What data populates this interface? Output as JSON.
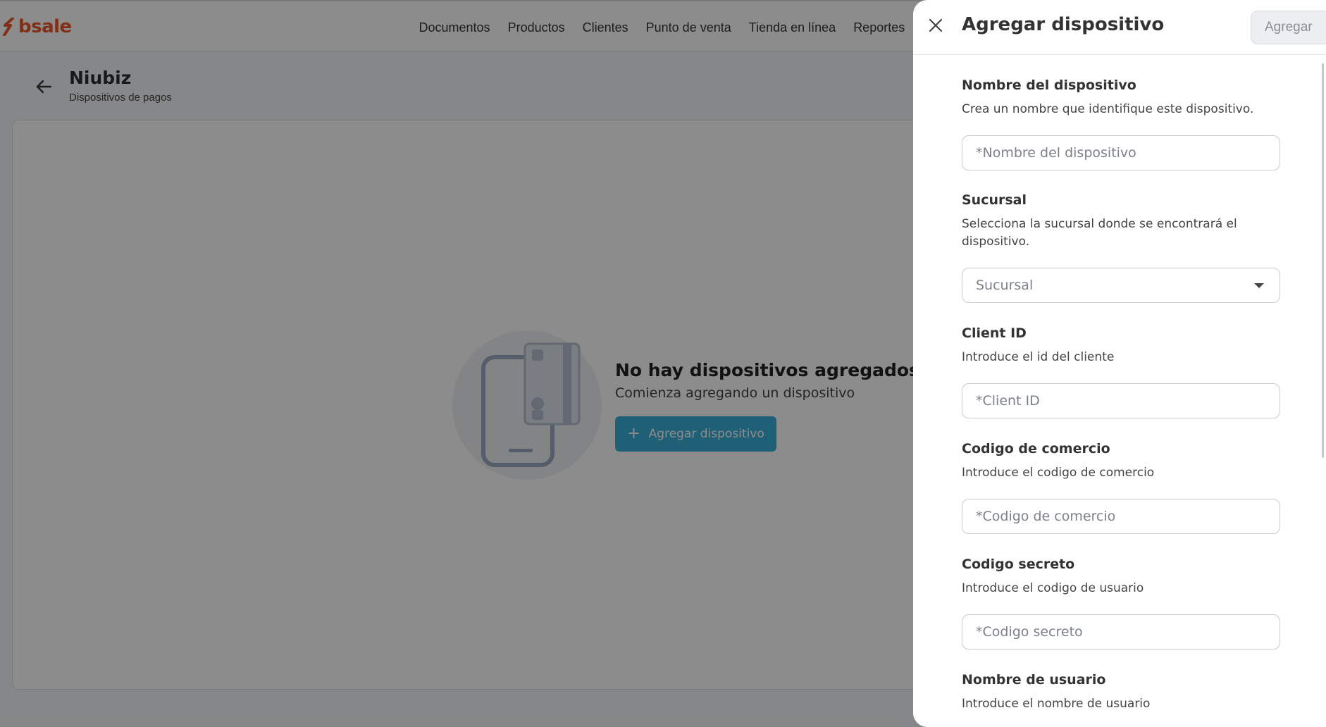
{
  "app": {
    "logo_text": "bsale",
    "brand_color": "#e8582a",
    "nav": [
      "Documentos",
      "Productos",
      "Clientes",
      "Punto de venta",
      "Tienda en línea",
      "Reportes"
    ]
  },
  "page": {
    "title": "Niubiz",
    "subtitle": "Dispositivos de pagos"
  },
  "empty_state": {
    "title": "No hay dispositivos agregados",
    "subtitle": "Comienza agregando un dispositivo",
    "button_icon": "+",
    "button_label": "Agregar dispositivo",
    "accent_color": "#3ab0d9"
  },
  "drawer": {
    "title": "Agregar dispositivo",
    "add_button": "Agregar",
    "fields": [
      {
        "label": "Nombre del dispositivo",
        "help": "Crea un nombre que identifique este dispositivo.",
        "placeholder": "*Nombre del dispositivo",
        "type": "text"
      },
      {
        "label": "Sucursal",
        "help": "Selecciona la sucursal donde se encontrará el dispositivo.",
        "placeholder": "Sucursal",
        "type": "select"
      },
      {
        "label": "Client ID",
        "help": "Introduce el id del cliente",
        "placeholder": "*Client ID",
        "type": "text"
      },
      {
        "label": "Codigo de comercio",
        "help": "Introduce el codigo de comercio",
        "placeholder": "*Codigo de comercio",
        "type": "text"
      },
      {
        "label": "Codigo secreto",
        "help": "Introduce el codigo de usuario",
        "placeholder": "*Codigo secreto",
        "type": "text"
      },
      {
        "label": "Nombre de usuario",
        "help": "Introduce el nombre de usuario"
      }
    ]
  }
}
